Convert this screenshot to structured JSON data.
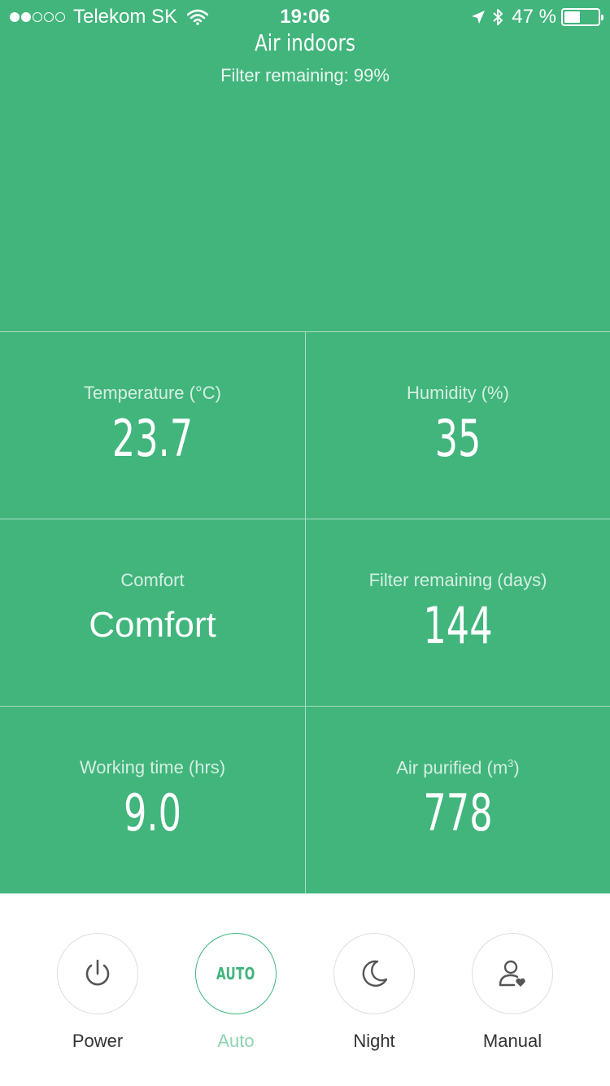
{
  "status_bar": {
    "carrier": "Telekom SK",
    "time": "19:06",
    "battery_percent": "47 %",
    "battery_level": 0.47,
    "signal_strength": 2,
    "icons": [
      "wifi-icon",
      "location-arrow-icon",
      "bluetooth-icon",
      "battery-icon"
    ]
  },
  "header": {
    "title": "Air indoors",
    "subtitle": "Filter remaining: 99%"
  },
  "stats": [
    {
      "label": "Temperature (°C)",
      "value": "23.7"
    },
    {
      "label": "Humidity (%)",
      "value": "35"
    },
    {
      "label": "Comfort",
      "value": "Comfort"
    },
    {
      "label": "Filter remaining (days)",
      "value": "144"
    },
    {
      "label": "Working time (hrs)",
      "value": "9.0"
    },
    {
      "label_prefix": "Air purified (m",
      "label_sup": "3",
      "label_suffix": ")",
      "value": "778"
    }
  ],
  "modes": [
    {
      "label": "Power",
      "icon": "power-icon",
      "active": false
    },
    {
      "label": "Auto",
      "icon_text": "AUTO",
      "active": true
    },
    {
      "label": "Night",
      "icon": "moon-icon",
      "active": false
    },
    {
      "label": "Manual",
      "icon": "user-heart-icon",
      "active": false
    }
  ],
  "colors": {
    "primary": "#41b57c",
    "active_label": "#8fd3b0",
    "inactive_label": "#333333",
    "circle_border": "#dedede"
  }
}
